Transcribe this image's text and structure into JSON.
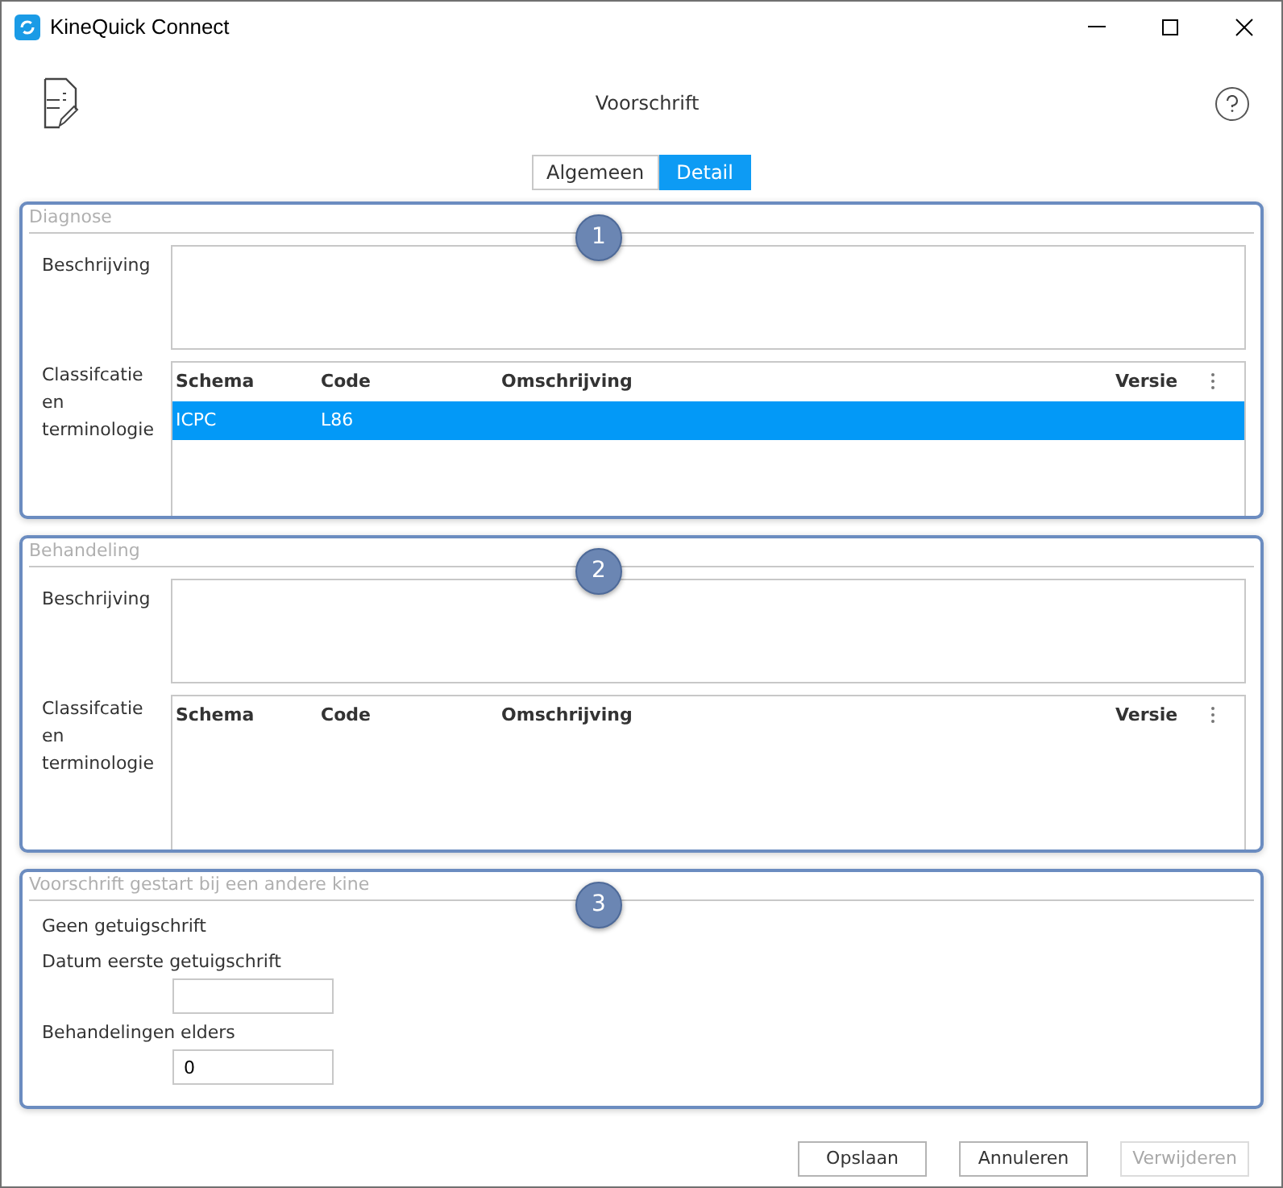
{
  "window": {
    "title": "KineQuick Connect"
  },
  "header": {
    "title": "Voorschrift"
  },
  "tabs": [
    {
      "label": "Algemeen",
      "selected": false
    },
    {
      "label": "Detail",
      "selected": true
    }
  ],
  "sections": [
    {
      "kind": "diagnosis",
      "title": "Diagnose",
      "marker": "1",
      "description_label": "Beschrijving",
      "classification_label": "Classifcatie en terminologie",
      "table": {
        "columns": [
          "Schema",
          "Code",
          "Omschrijving",
          "Versie"
        ],
        "rows": [
          {
            "cells": [
              "ICPC",
              "L86",
              "",
              ""
            ],
            "selected": true
          }
        ]
      }
    },
    {
      "kind": "diagnosis",
      "title": "Behandeling",
      "marker": "2",
      "description_label": "Beschrijving",
      "classification_label": "Classifcatie en terminologie",
      "table": {
        "columns": [
          "Schema",
          "Code",
          "Omschrijving",
          "Versie"
        ]
      }
    },
    {
      "kind": "fields",
      "title": "Voorschrift gestart bij een andere kine",
      "marker": "3",
      "note": "Geen getuigschrift",
      "fields": [
        {
          "label": "Datum eerste getuigschrift"
        },
        {
          "label": "Behandelingen elders",
          "value": "0"
        }
      ]
    }
  ],
  "buttons": [
    {
      "label": "Opslaan",
      "disabled": false
    },
    {
      "label": "Annuleren",
      "disabled": false
    },
    {
      "label": "Verwijderen",
      "disabled": true
    }
  ]
}
